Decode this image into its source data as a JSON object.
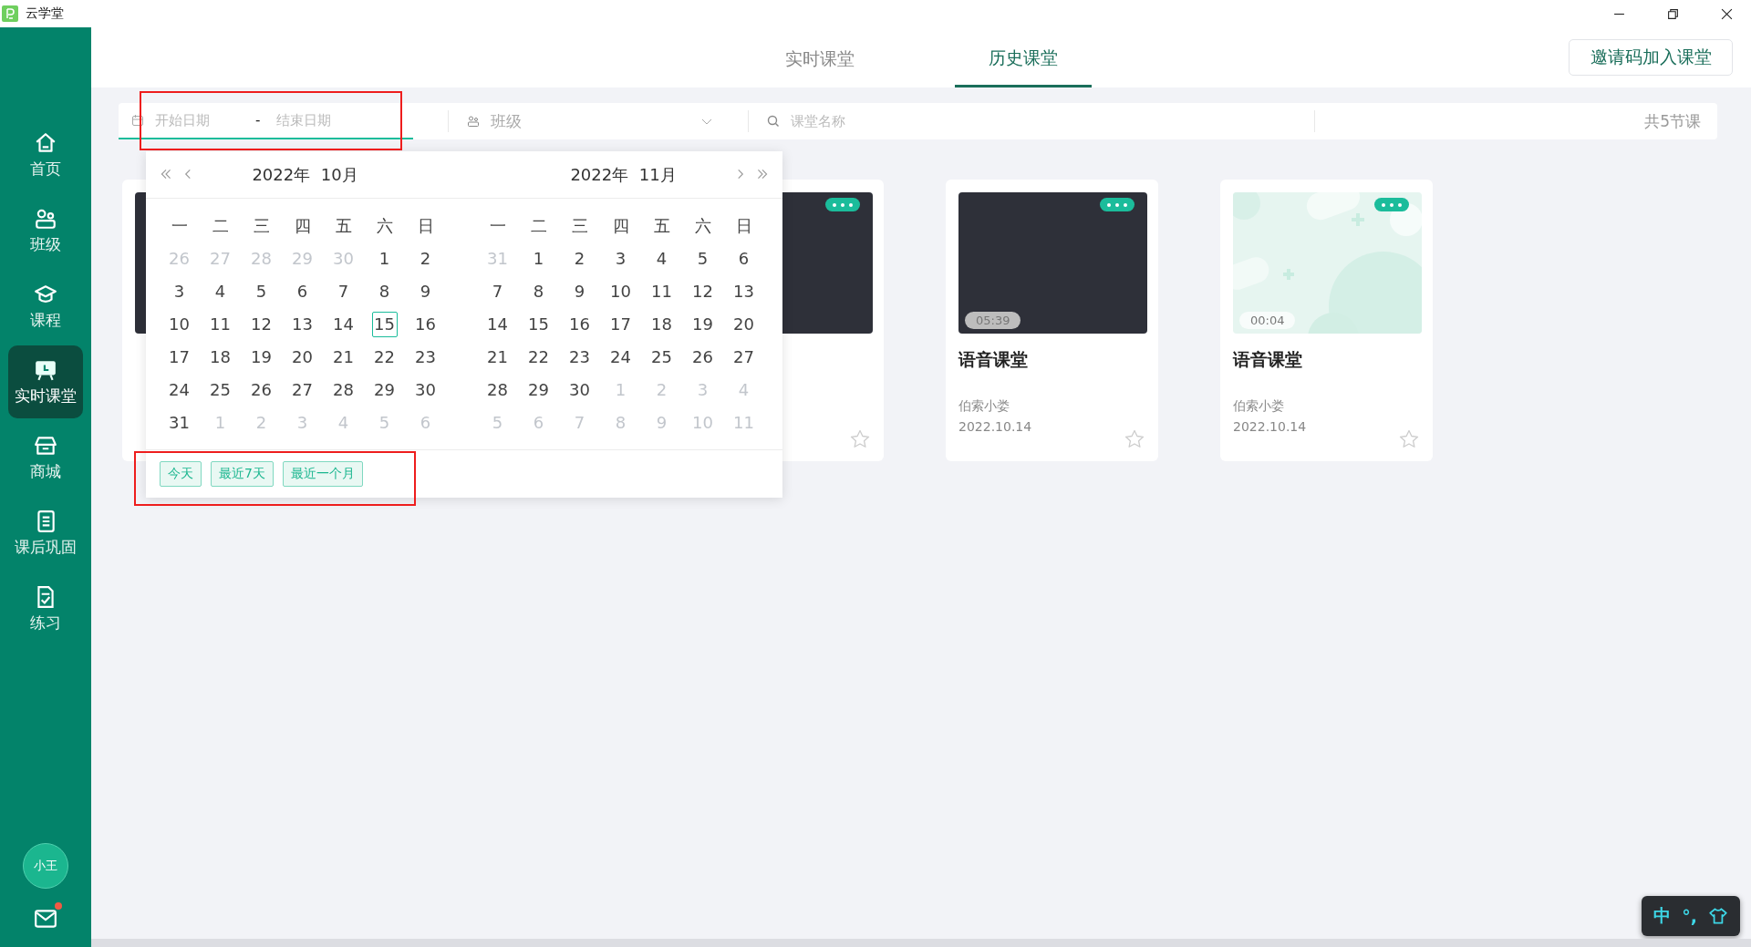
{
  "window": {
    "title": "云学堂"
  },
  "sidebar": {
    "items": [
      {
        "label": "首页",
        "kind": "home",
        "selected": false
      },
      {
        "label": "班级",
        "kind": "class",
        "selected": false
      },
      {
        "label": "课程",
        "kind": "course",
        "selected": false
      },
      {
        "label": "实时课堂",
        "kind": "live",
        "selected": true
      },
      {
        "label": "商城",
        "kind": "shop",
        "selected": false
      },
      {
        "label": "课后巩固",
        "kind": "notebook",
        "selected": false
      },
      {
        "label": "练习",
        "kind": "practice",
        "selected": false
      }
    ],
    "avatar": "小王",
    "mail_unread": true
  },
  "tabs": [
    {
      "label": "实时课堂",
      "selected": false
    },
    {
      "label": "历史课堂",
      "selected": true
    }
  ],
  "invite_button": "邀请码加入课堂",
  "filters": {
    "start_placeholder": "开始日期",
    "separator": "-",
    "end_placeholder": "结束日期",
    "class_placeholder": "班级",
    "search_placeholder": "课堂名称",
    "count": "共5节课"
  },
  "calendar": {
    "months": [
      {
        "title": "2022年  10月",
        "weekdays": [
          "一",
          "二",
          "三",
          "四",
          "五",
          "六",
          "日"
        ],
        "days": [
          {
            "d": "26",
            "muted": true,
            "today": false
          },
          {
            "d": "27",
            "muted": true,
            "today": false
          },
          {
            "d": "28",
            "muted": true,
            "today": false
          },
          {
            "d": "29",
            "muted": true,
            "today": false
          },
          {
            "d": "30",
            "muted": true,
            "today": false
          },
          {
            "d": "1",
            "muted": false,
            "today": false
          },
          {
            "d": "2",
            "muted": false,
            "today": false
          },
          {
            "d": "3",
            "muted": false,
            "today": false
          },
          {
            "d": "4",
            "muted": false,
            "today": false
          },
          {
            "d": "5",
            "muted": false,
            "today": false
          },
          {
            "d": "6",
            "muted": false,
            "today": false
          },
          {
            "d": "7",
            "muted": false,
            "today": false
          },
          {
            "d": "8",
            "muted": false,
            "today": false
          },
          {
            "d": "9",
            "muted": false,
            "today": false
          },
          {
            "d": "10",
            "muted": false,
            "today": false
          },
          {
            "d": "11",
            "muted": false,
            "today": false
          },
          {
            "d": "12",
            "muted": false,
            "today": false
          },
          {
            "d": "13",
            "muted": false,
            "today": false
          },
          {
            "d": "14",
            "muted": false,
            "today": false
          },
          {
            "d": "15",
            "muted": false,
            "today": true
          },
          {
            "d": "16",
            "muted": false,
            "today": false
          },
          {
            "d": "17",
            "muted": false,
            "today": false
          },
          {
            "d": "18",
            "muted": false,
            "today": false
          },
          {
            "d": "19",
            "muted": false,
            "today": false
          },
          {
            "d": "20",
            "muted": false,
            "today": false
          },
          {
            "d": "21",
            "muted": false,
            "today": false
          },
          {
            "d": "22",
            "muted": false,
            "today": false
          },
          {
            "d": "23",
            "muted": false,
            "today": false
          },
          {
            "d": "24",
            "muted": false,
            "today": false
          },
          {
            "d": "25",
            "muted": false,
            "today": false
          },
          {
            "d": "26",
            "muted": false,
            "today": false
          },
          {
            "d": "27",
            "muted": false,
            "today": false
          },
          {
            "d": "28",
            "muted": false,
            "today": false
          },
          {
            "d": "29",
            "muted": false,
            "today": false
          },
          {
            "d": "30",
            "muted": false,
            "today": false
          },
          {
            "d": "31",
            "muted": false,
            "today": false
          },
          {
            "d": "1",
            "muted": true,
            "today": false
          },
          {
            "d": "2",
            "muted": true,
            "today": false
          },
          {
            "d": "3",
            "muted": true,
            "today": false
          },
          {
            "d": "4",
            "muted": true,
            "today": false
          },
          {
            "d": "5",
            "muted": true,
            "today": false
          },
          {
            "d": "6",
            "muted": true,
            "today": false
          }
        ]
      },
      {
        "title": "2022年  11月",
        "weekdays": [
          "一",
          "二",
          "三",
          "四",
          "五",
          "六",
          "日"
        ],
        "days": [
          {
            "d": "31",
            "muted": true,
            "today": false
          },
          {
            "d": "1",
            "muted": false,
            "today": false
          },
          {
            "d": "2",
            "muted": false,
            "today": false
          },
          {
            "d": "3",
            "muted": false,
            "today": false
          },
          {
            "d": "4",
            "muted": false,
            "today": false
          },
          {
            "d": "5",
            "muted": false,
            "today": false
          },
          {
            "d": "6",
            "muted": false,
            "today": false
          },
          {
            "d": "7",
            "muted": false,
            "today": false
          },
          {
            "d": "8",
            "muted": false,
            "today": false
          },
          {
            "d": "9",
            "muted": false,
            "today": false
          },
          {
            "d": "10",
            "muted": false,
            "today": false
          },
          {
            "d": "11",
            "muted": false,
            "today": false
          },
          {
            "d": "12",
            "muted": false,
            "today": false
          },
          {
            "d": "13",
            "muted": false,
            "today": false
          },
          {
            "d": "14",
            "muted": false,
            "today": false
          },
          {
            "d": "15",
            "muted": false,
            "today": false
          },
          {
            "d": "16",
            "muted": false,
            "today": false
          },
          {
            "d": "17",
            "muted": false,
            "today": false
          },
          {
            "d": "18",
            "muted": false,
            "today": false
          },
          {
            "d": "19",
            "muted": false,
            "today": false
          },
          {
            "d": "20",
            "muted": false,
            "today": false
          },
          {
            "d": "21",
            "muted": false,
            "today": false
          },
          {
            "d": "22",
            "muted": false,
            "today": false
          },
          {
            "d": "23",
            "muted": false,
            "today": false
          },
          {
            "d": "24",
            "muted": false,
            "today": false
          },
          {
            "d": "25",
            "muted": false,
            "today": false
          },
          {
            "d": "26",
            "muted": false,
            "today": false
          },
          {
            "d": "27",
            "muted": false,
            "today": false
          },
          {
            "d": "28",
            "muted": false,
            "today": false
          },
          {
            "d": "29",
            "muted": false,
            "today": false
          },
          {
            "d": "30",
            "muted": false,
            "today": false
          },
          {
            "d": "1",
            "muted": true,
            "today": false
          },
          {
            "d": "2",
            "muted": true,
            "today": false
          },
          {
            "d": "3",
            "muted": true,
            "today": false
          },
          {
            "d": "4",
            "muted": true,
            "today": false
          },
          {
            "d": "5",
            "muted": true,
            "today": false
          },
          {
            "d": "6",
            "muted": true,
            "today": false
          },
          {
            "d": "7",
            "muted": true,
            "today": false
          },
          {
            "d": "8",
            "muted": true,
            "today": false
          },
          {
            "d": "9",
            "muted": true,
            "today": false
          },
          {
            "d": "10",
            "muted": true,
            "today": false
          },
          {
            "d": "11",
            "muted": true,
            "today": false
          }
        ]
      }
    ],
    "shortcuts": [
      "今天",
      "最近7天",
      "最近一个月"
    ]
  },
  "cards": [
    {
      "kind": "video"
    },
    {
      "kind": "video",
      "starred": false
    },
    {
      "kind": "video",
      "duration": "05:39",
      "title": "语音课堂",
      "author": "伯索小娄",
      "date": "2022.10.14",
      "starred": false
    },
    {
      "kind": "picture",
      "duration": "00:04",
      "title": "语音课堂",
      "author": "伯索小娄",
      "date": "2022.10.14",
      "starred": false
    }
  ],
  "ime": {
    "mode": "中",
    "punct": "°,"
  }
}
